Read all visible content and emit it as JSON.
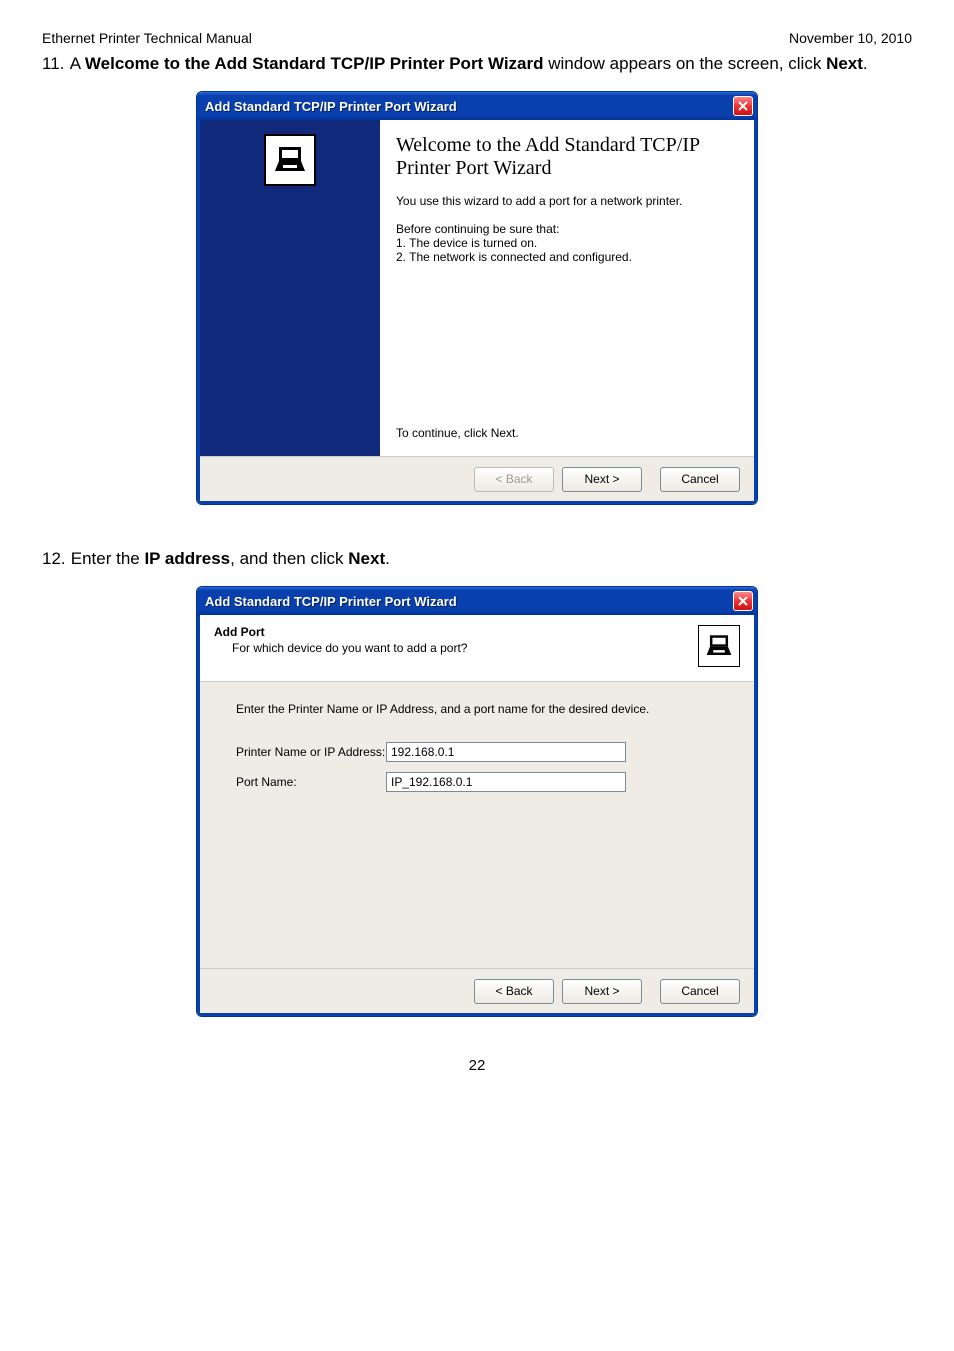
{
  "header": {
    "left": "Ethernet Printer Technical Manual",
    "right": "November 10, 2010"
  },
  "step11": {
    "number": "11.",
    "prefix": "A ",
    "bold": "Welcome to the Add Standard TCP/IP Printer Port Wizard",
    "mid": " window appears on the screen, click ",
    "bold2": "Next",
    "suffix": "."
  },
  "step12": {
    "number": "12.",
    "prefix": "Enter the ",
    "bold": "IP address",
    "mid": ", and then click ",
    "bold2": "Next",
    "suffix": "."
  },
  "dialog_common": {
    "title": "Add Standard TCP/IP Printer Port Wizard",
    "back": "< Back",
    "next": "Next >",
    "cancel": "Cancel"
  },
  "dialog1": {
    "heading": "Welcome to the Add Standard TCP/IP Printer Port Wizard",
    "para1": "You use this wizard to add a port for a network printer.",
    "para2a": "Before continuing be sure that:",
    "para2b": "1.  The device is turned on.",
    "para2c": "2.  The network is connected and configured.",
    "continue": "To continue, click Next."
  },
  "dialog2": {
    "head_title": "Add Port",
    "head_sub": "For which device do you want to add a port?",
    "intro": "Enter the Printer Name or IP Address, and a port name for the desired device.",
    "label_ip": "Printer Name or IP Address:",
    "label_port": "Port Name:",
    "value_ip": "192.168.0.1",
    "value_port": "IP_192.168.0.1"
  },
  "page_number": "22"
}
